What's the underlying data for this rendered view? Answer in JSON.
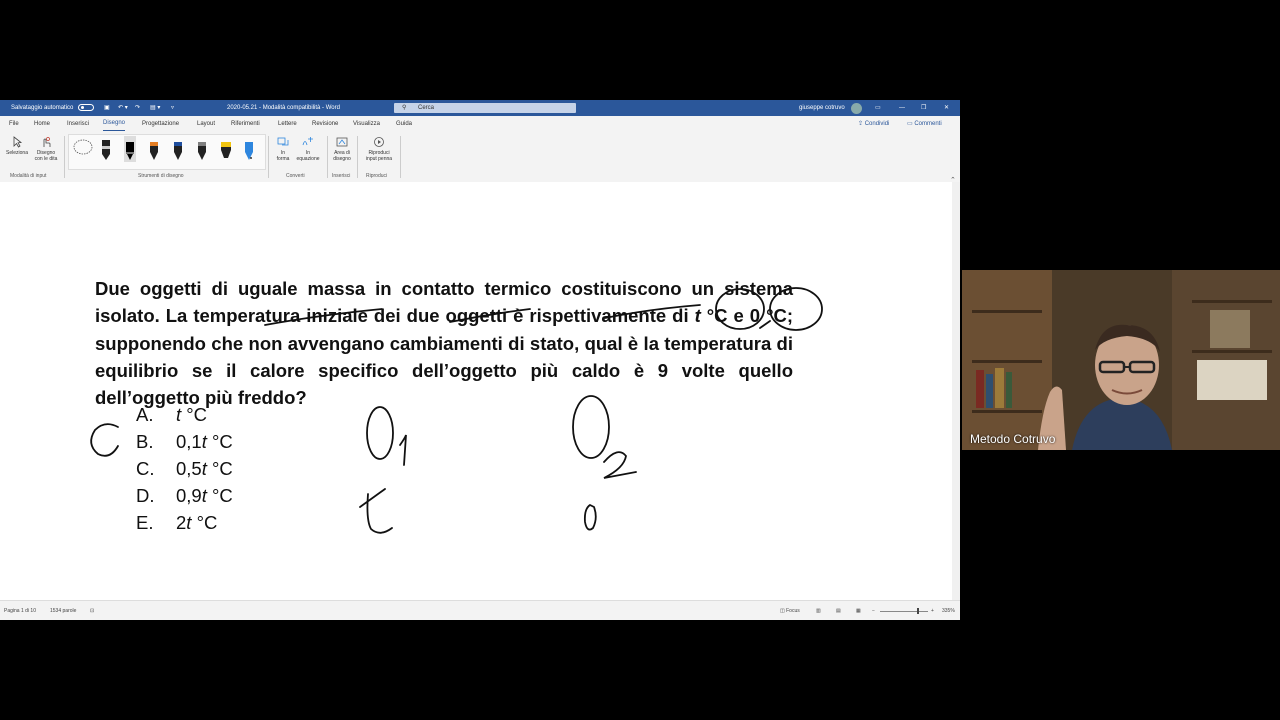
{
  "titlebar": {
    "autosave_label": "Salvataggio automatico",
    "document_title": "2020-05.21 - Modalità compatibilità - Word",
    "search_placeholder": "Cerca",
    "user_name": "giuseppe cotruvo",
    "accent_color": "#2b579a"
  },
  "menu": {
    "tabs": [
      "File",
      "Home",
      "Inserisci",
      "Disegno",
      "Progettazione",
      "Layout",
      "Riferimenti",
      "Lettere",
      "Revisione",
      "Visualizza",
      "Guida"
    ],
    "active_tab": "Disegno",
    "share_label": "Condividi",
    "comments_label": "Commenti"
  },
  "ribbon": {
    "select_label": "Seleziona",
    "touch_draw_label_1": "Disegno",
    "touch_draw_label_2": "con le dita",
    "input_mode_group": "Modalità di input",
    "drawing_tools_group": "Strumenti di disegno",
    "to_shape_label_1": "In",
    "to_shape_label_2": "forma",
    "to_math_label_1": "In",
    "to_math_label_2": "equazione",
    "convert_group": "Converti",
    "canvas_label_1": "Area di",
    "canvas_label_2": "disegno",
    "insert_group": "Inserisci",
    "replay_label_1": "Riproduci",
    "replay_label_2": "input penna",
    "replay_group": "Riproduci",
    "pen_colors": [
      "#000000",
      "#e74c3c",
      "#000000",
      "#e67e22",
      "#1f4e9e",
      "#7f7f7f",
      "#f1c40f",
      "#2e86de"
    ]
  },
  "document": {
    "paragraph": "Due oggetti di uguale massa in contatto termico costituiscono un sistema isolato. La temperatura iniziale dei due oggetti è rispettivamente di t °C e 0 °C; supponendo che non avvengano cambiamenti di stato, qual è la temperatura di equilibrio se il calore specifico dell’oggetto più caldo è 9 volte quello dell’oggetto più freddo?",
    "options": [
      {
        "letter": "A.",
        "prefix": "",
        "var": "t",
        "unit": " °C"
      },
      {
        "letter": "B.",
        "prefix": "0,1",
        "var": "t",
        "unit": " °C"
      },
      {
        "letter": "C.",
        "prefix": "0,5",
        "var": "t",
        "unit": " °C"
      },
      {
        "letter": "D.",
        "prefix": "0,9",
        "var": "t",
        "unit": " °C"
      },
      {
        "letter": "E.",
        "prefix": "2",
        "var": "t",
        "unit": " °C"
      }
    ]
  },
  "statusbar": {
    "page": "Pagina 1 di 10",
    "words": "1534 parole",
    "focus": "Focus",
    "zoom": "335%"
  },
  "webcam": {
    "participant_name": "Metodo Cotruvo"
  }
}
